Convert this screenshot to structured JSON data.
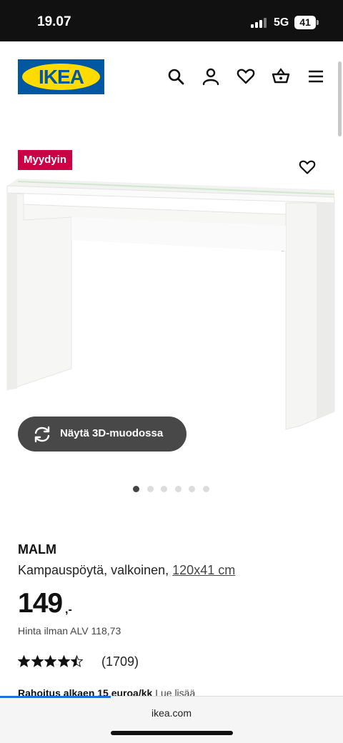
{
  "status_bar": {
    "time": "19.07",
    "network": "5G",
    "battery": "41"
  },
  "header": {
    "logo_text": "IKEA",
    "icons": [
      "search-icon",
      "user-icon",
      "heart-icon",
      "basket-icon",
      "menu-icon"
    ]
  },
  "product_image": {
    "badge": "Myydyin",
    "view_3d_label": "Näytä 3D-muodossa",
    "carousel_total": 6,
    "carousel_active": 1
  },
  "product": {
    "name": "MALM",
    "description": "Kampauspöytä, valkoinen,",
    "size": "120x41 cm",
    "price": "149",
    "price_suffix": ",-",
    "price_vat": "Hinta ilman ALV 118,73",
    "rating": 4.5,
    "rating_max": 5,
    "review_count": "(1709)"
  },
  "financing": {
    "text": "Rahoitus alkaen 15 euroa/kk",
    "link": "Lue lisää"
  },
  "browser": {
    "url": "ikea.com"
  },
  "colors": {
    "ikea_blue": "#0058a3",
    "ikea_yellow": "#ffdb00",
    "badge_red": "#cc0044"
  }
}
